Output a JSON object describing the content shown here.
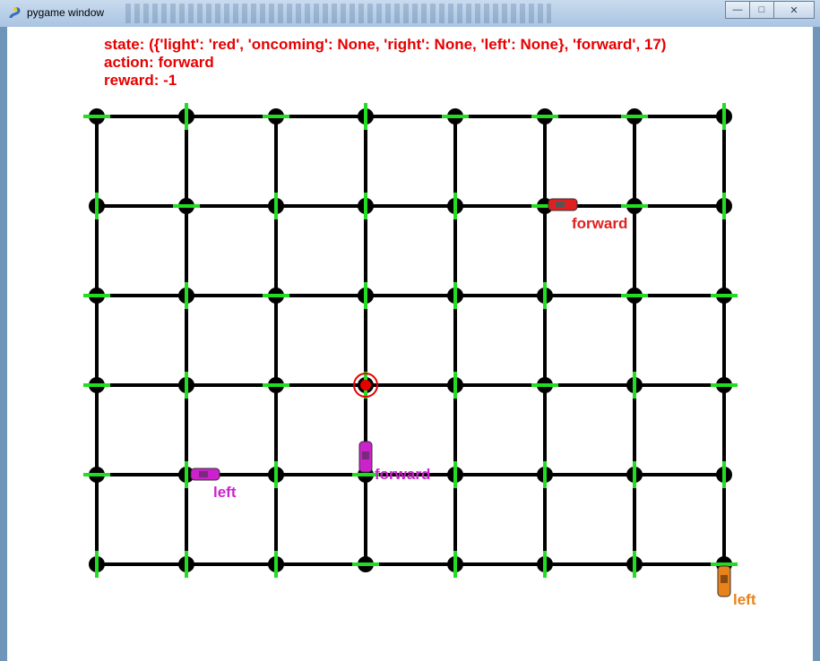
{
  "window": {
    "title": "pygame window",
    "minimize_glyph": "—",
    "maximize_glyph": "□",
    "close_glyph": "✕"
  },
  "hud": {
    "state": "state: ({'light': 'red', 'oncoming': None, 'right': None, 'left': None}, 'forward', 17)",
    "action": "action: forward",
    "reward": "reward: -1"
  },
  "colors": {
    "road": "#000000",
    "signal": "#22dd22",
    "hud": "#e60000",
    "destination": "#e60000"
  },
  "cars": [
    {
      "color": "#e02020",
      "label": "forward"
    },
    {
      "color": "#cc22cc",
      "label": "forward"
    },
    {
      "color": "#cc22cc",
      "label": "left"
    },
    {
      "color": "#e8821a",
      "label": "left"
    }
  ]
}
